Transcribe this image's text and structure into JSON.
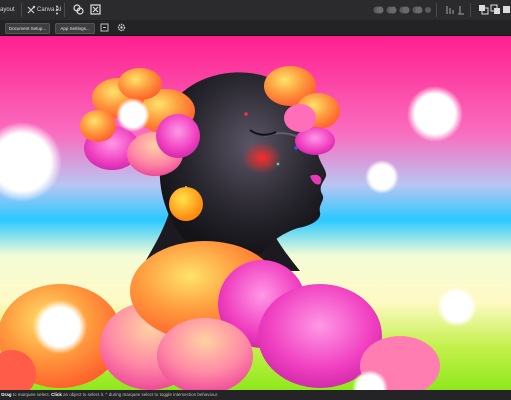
{
  "toolbar": {
    "persona_label": "ayout",
    "canva_ai_label": "Canva AI"
  },
  "context_bar": {
    "document_setup_label": "Document Setup...",
    "app_settings_label": "App Settings..."
  },
  "status_bar": {
    "drag_key": "Drag",
    "drag_text": "to marquee select.",
    "click_key": "Click",
    "click_text": "an object to select it.",
    "modifier_text": "^ during marquee select to toggle intersection behaviour."
  },
  "icons": [
    "canva-ai-icon",
    "more-icon",
    "assets-icon",
    "export-icon",
    "boolean-icons",
    "align-icons",
    "arrange-icons",
    "file-icon",
    "settings-icon"
  ],
  "colors": {
    "ui_background": "#1d1d1f",
    "toolbar": "#2b2b2d",
    "canvas_top": "#ff1f8e",
    "canvas_mid": "#1ec8ff",
    "canvas_bottom": "#a8ef1e"
  }
}
